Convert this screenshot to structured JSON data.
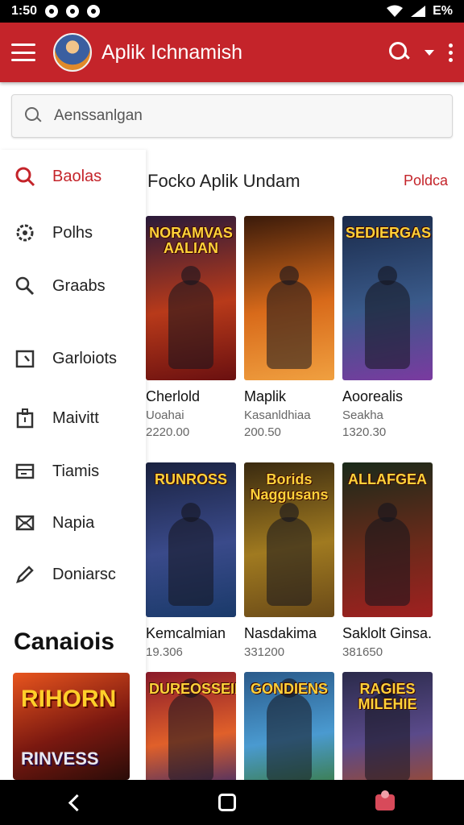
{
  "status_bar": {
    "time": "1:50",
    "battery": "E%"
  },
  "app_bar": {
    "title": "Aplik Ichnamish"
  },
  "search": {
    "placeholder": "Aenssanlgan"
  },
  "drawer": {
    "items": [
      {
        "label": "Baolas",
        "icon": "search-icon",
        "active": true
      },
      {
        "label": "Polhs",
        "icon": "gear-icon",
        "active": false
      },
      {
        "label": "Graabs",
        "icon": "zoom-icon",
        "active": false
      },
      {
        "label": "Garloiots",
        "icon": "calendar-icon",
        "active": false
      },
      {
        "label": "Maivitt",
        "icon": "bag-icon",
        "active": false
      },
      {
        "label": "Tiamis",
        "icon": "card-icon",
        "active": false
      },
      {
        "label": "Napia",
        "icon": "envelope-icon",
        "active": false
      },
      {
        "label": "Doniarsc",
        "icon": "pencil-icon",
        "active": false
      }
    ],
    "section_title": "Canaiois",
    "card_title": "RIHORN",
    "card_subtitle": "RINVESS"
  },
  "content": {
    "section_title": "Focko Aplik Undam",
    "section_link": "Poldca",
    "cards": [
      {
        "poster_title": "NORAMVAS AALIAN",
        "name": "Cherlold",
        "sub": "Uoahai",
        "num": "2220.00",
        "colors": [
          "#2a1a3a",
          "#b83a1a",
          "#6a1010"
        ]
      },
      {
        "poster_title": "",
        "name": "Maplik",
        "sub": "Kasanldhiaa",
        "num": "200.50",
        "colors": [
          "#3a1a0a",
          "#d86a1a",
          "#f0a040"
        ]
      },
      {
        "poster_title": "SEDIERGAS",
        "name": "Aoorealis",
        "sub": "Seakha",
        "num": "1320.30",
        "colors": [
          "#1a2a4a",
          "#3a5a8a",
          "#7a3aa0"
        ]
      },
      {
        "poster_title": "RUNROSS",
        "name": "Kemcalmian",
        "sub": "",
        "num": "19.306",
        "colors": [
          "#1a2240",
          "#3a4a8a",
          "#1a3a6a"
        ]
      },
      {
        "poster_title": "Borids Naggusans",
        "name": "Nasdakima",
        "sub": "",
        "num": "331200",
        "colors": [
          "#3a2a10",
          "#a07a20",
          "#6a4a18"
        ]
      },
      {
        "poster_title": "ALLAFGEA",
        "name": "Saklolt Ginsa.",
        "sub": "",
        "num": "381650",
        "colors": [
          "#1a2a1a",
          "#6a2a1a",
          "#a02020"
        ]
      },
      {
        "poster_title": "DUREOSSEIBE",
        "name": "",
        "sub": "",
        "num": "",
        "colors": [
          "#8a1a2a",
          "#e0602a",
          "#3a2a6a"
        ]
      },
      {
        "poster_title": "GONDIENS",
        "name": "",
        "sub": "",
        "num": "",
        "colors": [
          "#2a5a8a",
          "#4a9ad0",
          "#3a7a3a"
        ]
      },
      {
        "poster_title": "RAGIES MILEHIE",
        "name": "",
        "sub": "",
        "num": "",
        "colors": [
          "#2a2a4a",
          "#5a4a8a",
          "#a04a2a"
        ]
      }
    ]
  }
}
